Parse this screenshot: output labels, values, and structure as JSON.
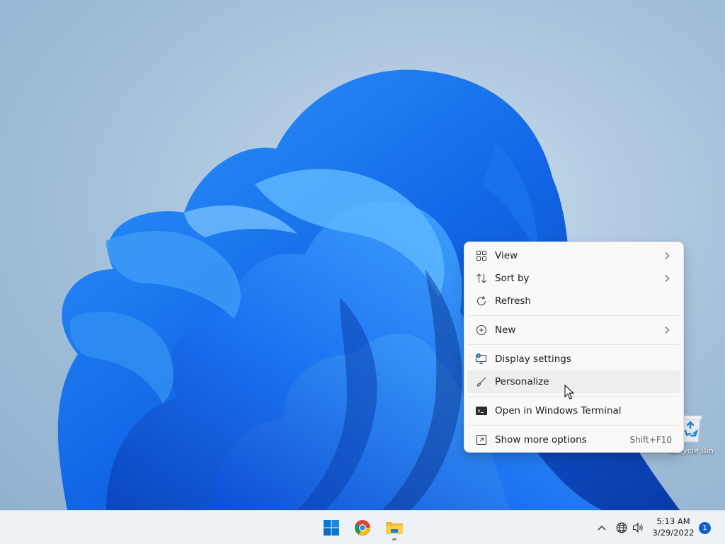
{
  "desktop": {
    "recycle_bin_label": "Recycle Bin"
  },
  "context_menu": {
    "items": [
      {
        "label": "View",
        "icon": "view-grid-icon",
        "submenu": true
      },
      {
        "label": "Sort by",
        "icon": "sort-icon",
        "submenu": true
      },
      {
        "label": "Refresh",
        "icon": "refresh-icon",
        "submenu": false
      },
      {
        "label": "New",
        "icon": "new-plus-icon",
        "submenu": true
      },
      {
        "label": "Display settings",
        "icon": "display-settings-icon",
        "submenu": false
      },
      {
        "label": "Personalize",
        "icon": "brush-icon",
        "submenu": false,
        "hovered": true
      },
      {
        "label": "Open in Windows Terminal",
        "icon": "terminal-icon",
        "submenu": false
      },
      {
        "label": "Show more options",
        "icon": "more-options-icon",
        "shortcut": "Shift+F10"
      }
    ]
  },
  "taskbar": {
    "apps": [
      {
        "name": "Start",
        "icon": "windows-start-icon"
      },
      {
        "name": "Google Chrome",
        "icon": "chrome-icon"
      },
      {
        "name": "File Explorer",
        "icon": "file-explorer-icon",
        "running": true
      }
    ],
    "tray": {
      "icons": [
        "chevron-up-icon",
        "network-globe-icon",
        "volume-icon"
      ],
      "time": "5:13 AM",
      "date": "3/29/2022",
      "notification_count": "1"
    }
  },
  "colors": {
    "accent": "#0067c0",
    "menu_background": "#f9f9f9",
    "taskbar_background": "#eef1f6",
    "badge": "#1060c8"
  }
}
